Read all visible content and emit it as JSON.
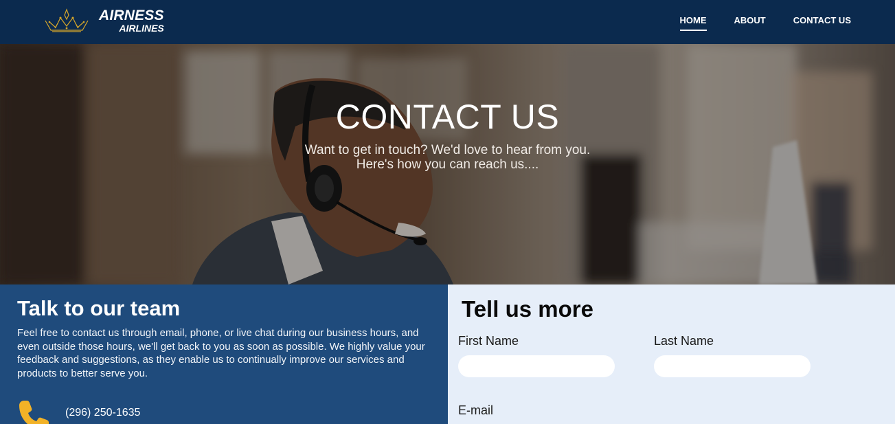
{
  "brand": {
    "line1": "AIRNESS",
    "line2": "AIRLINES",
    "logo_icon": "crown-icon"
  },
  "nav": {
    "home": "HOME",
    "about": "ABOUT",
    "contact": "CONTACT US",
    "active": "HOME"
  },
  "hero": {
    "title": "CONTACT US",
    "subtitle_line1": "Want to get in touch? We'd love to hear from you.",
    "subtitle_line2": "Here's how you can reach us...."
  },
  "team": {
    "title": "Talk to our team",
    "body": "Feel free to contact us through email, phone, or live chat during our business hours, and even outside those hours, we'll get back to you as soon as possible. We highly value your feedback and suggestions, as they enable us to continually improve our services and products to better serve you.",
    "phone_icon": "phone-icon",
    "phone": "(296) 250-1635"
  },
  "form": {
    "title": "Tell us more",
    "first_name_label": "First Name",
    "first_name_value": "",
    "last_name_label": "Last Name",
    "last_name_value": "",
    "email_label": "E-mail"
  },
  "colors": {
    "navbar": "#0b2a4e",
    "left_panel": "#1f4b7c",
    "right_panel": "#e6eef9",
    "accent_gold": "#f2b227"
  }
}
